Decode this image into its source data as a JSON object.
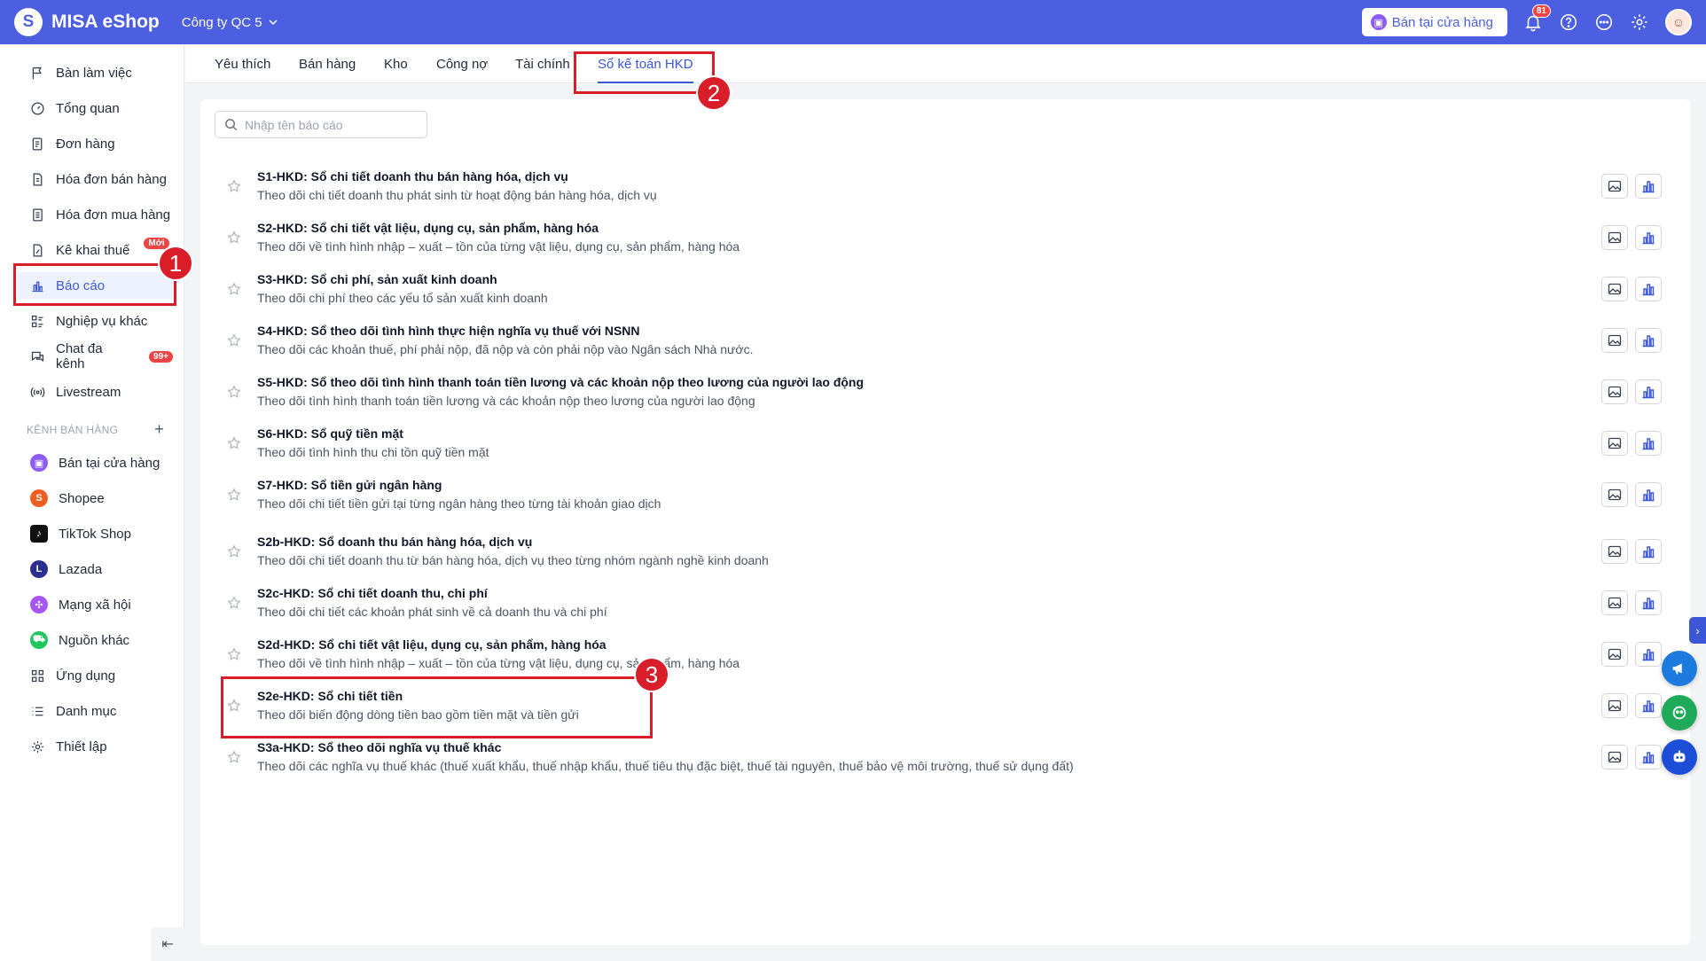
{
  "app": {
    "title": "MISA eShop",
    "logo_letter": "S",
    "company": "Công ty QC 5"
  },
  "topbar": {
    "store_button": "Bán tại cửa hàng",
    "notification_count": "81",
    "avatar_initial": "☺"
  },
  "sidebar": {
    "items": [
      {
        "label": "Bàn làm việc",
        "icon": "flag-icon"
      },
      {
        "label": "Tổng quan",
        "icon": "gauge-icon"
      },
      {
        "label": "Đơn hàng",
        "icon": "order-icon"
      },
      {
        "label": "Hóa đơn bán hàng",
        "icon": "invoice-icon"
      },
      {
        "label": "Hóa đơn mua hàng",
        "icon": "purchase-invoice-icon"
      },
      {
        "label": "Kê khai thuế",
        "icon": "tax-icon",
        "badge": "Mới"
      },
      {
        "label": "Báo cáo",
        "icon": "bar-chart-icon",
        "active": true
      },
      {
        "label": "Nghiệp vụ khác",
        "icon": "list-icon"
      },
      {
        "label": "Chat đa kênh",
        "icon": "chat-icon",
        "badge": "99+"
      },
      {
        "label": "Livestream",
        "icon": "broadcast-icon"
      }
    ],
    "channels_label": "KÊNH BÁN HÀNG",
    "channels": [
      {
        "label": "Bán tại cửa hàng",
        "icon": "store-icon",
        "color": "#8b5cf6"
      },
      {
        "label": "Shopee",
        "icon": "shopee-icon",
        "color": "#f05d23"
      },
      {
        "label": "TikTok Shop",
        "icon": "tiktok-icon",
        "color": "#111111"
      },
      {
        "label": "Lazada",
        "icon": "lazada-icon",
        "color": "#2a2f8f"
      },
      {
        "label": "Mạng xã hội",
        "icon": "social-icon",
        "color": "#a855f7"
      },
      {
        "label": "Nguồn khác",
        "icon": "cart-icon",
        "color": "#22c55e"
      }
    ],
    "bottom_items": [
      {
        "label": "Ứng dụng",
        "icon": "apps-icon"
      },
      {
        "label": "Danh mục",
        "icon": "catalog-icon"
      },
      {
        "label": "Thiết lập",
        "icon": "gear-icon"
      }
    ]
  },
  "tabs": [
    {
      "label": "Yêu thích"
    },
    {
      "label": "Bán hàng"
    },
    {
      "label": "Kho"
    },
    {
      "label": "Công nợ"
    },
    {
      "label": "Tài chính"
    },
    {
      "label": "Sổ kế toán HKD",
      "active": true
    }
  ],
  "search": {
    "placeholder": "Nhập tên báo cáo"
  },
  "reports": [
    {
      "title": "S1-HKD: Sổ chi tiết doanh thu bán hàng hóa, dịch vụ",
      "desc": "Theo dõi chi tiết doanh thu phát sinh từ hoạt động bán hàng hóa, dịch vụ"
    },
    {
      "title": "S2-HKD: Sổ chi tiết vật liệu, dụng cụ, sản phẩm, hàng hóa",
      "desc": "Theo dõi về tình hình nhập – xuất – tồn của từng vật liệu, dụng cụ, sản phẩm, hàng hóa"
    },
    {
      "title": "S3-HKD: Sổ chi phí, sản xuất kinh doanh",
      "desc": "Theo dõi chi phí theo các yếu tố sản xuất kinh doanh"
    },
    {
      "title": "S4-HKD: Sổ theo dõi tình hình thực hiện nghĩa vụ thuế với NSNN",
      "desc": "Theo dõi các khoản thuế, phí phải nộp, đã nộp và còn phải nộp vào Ngân sách Nhà nước."
    },
    {
      "title": "S5-HKD: Sổ theo dõi tình hình thanh toán tiền lương và các khoản nộp theo lương của người lao động",
      "desc": "Theo dõi tình hình thanh toán tiền lương và các khoản nộp theo lương của người lao động"
    },
    {
      "title": "S6-HKD: Sổ quỹ tiền mặt",
      "desc": "Theo dõi tình hình thu chi tồn quỹ tiền mặt"
    },
    {
      "title": "S7-HKD: Sổ tiền gửi ngân hàng",
      "desc": "Theo dõi chi tiết tiền gửi tại từng ngân hàng theo từng tài khoản giao dịch"
    },
    {
      "title": "S2b-HKD: Sổ doanh thu bán hàng hóa, dịch vụ",
      "desc": "Theo dõi chi tiết doanh thu từ bán hàng hóa, dịch vụ theo từng nhóm ngành nghề kinh doanh"
    },
    {
      "title": "S2c-HKD: Sổ chi tiết doanh thu, chi phí",
      "desc": "Theo dõi chi tiết các khoản phát sinh về cả doanh thu và chi phí"
    },
    {
      "title": "S2d-HKD: Sổ chi tiết vật liệu, dụng cụ, sản phẩm, hàng hóa",
      "desc": "Theo dõi về tình hình nhập – xuất – tồn của từng vật liệu, dụng cụ, sản phẩm, hàng hóa"
    },
    {
      "title": "S2e-HKD: Sổ chi tiết tiền",
      "desc": "Theo dõi biến động dòng tiền bao gồm tiền mặt và tiền gửi"
    },
    {
      "title": "S3a-HKD: Sổ theo dõi nghĩa vụ thuế khác",
      "desc": "Theo dõi các nghĩa vụ thuế khác (thuế xuất khẩu, thuế nhập khẩu, thuế tiêu thụ đặc biệt, thuế tài nguyên, thuế bảo vệ môi trường, thuế sử dụng đất)"
    }
  ],
  "annotations": [
    {
      "number": "1"
    },
    {
      "number": "2"
    },
    {
      "number": "3"
    }
  ],
  "colors": {
    "brand": "#4b5fe0",
    "active": "#3b57d8",
    "highlight": "#d91e2a"
  }
}
